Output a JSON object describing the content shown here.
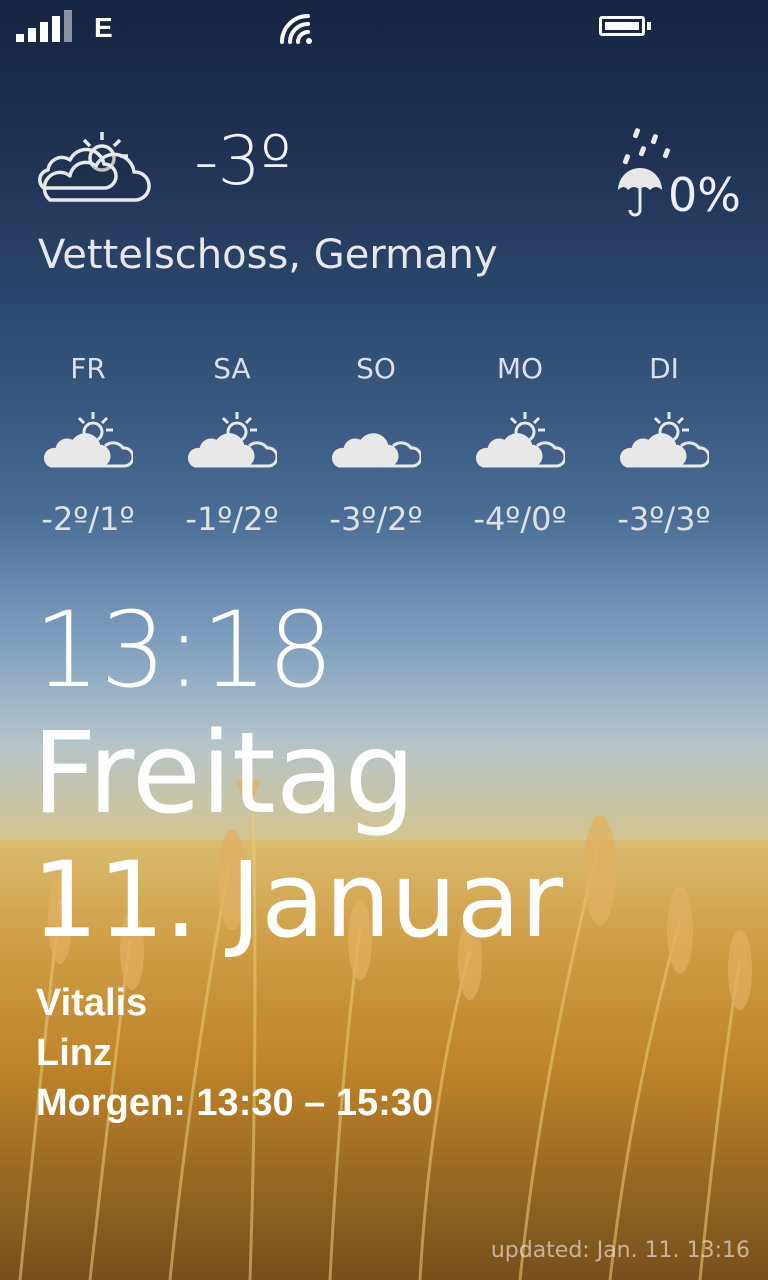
{
  "status": {
    "network_type": "E",
    "icons": [
      "signal-icon",
      "wifi-icon",
      "battery-icon"
    ]
  },
  "weather": {
    "current_temp": "-3º",
    "precip_chance": "0%",
    "location": "Vettelschoss, Germany",
    "current_icon": "partly-cloudy-icon",
    "precip_icon": "umbrella-rain-icon",
    "forecast": [
      {
        "day": "FR",
        "range": "-2º/1º",
        "icon": "partly-cloudy-icon"
      },
      {
        "day": "SA",
        "range": "-1º/2º",
        "icon": "partly-cloudy-icon"
      },
      {
        "day": "SO",
        "range": "-3º/2º",
        "icon": "cloudy-icon"
      },
      {
        "day": "MO",
        "range": "-4º/0º",
        "icon": "partly-cloudy-icon"
      },
      {
        "day": "DI",
        "range": "-3º/3º",
        "icon": "partly-cloudy-icon"
      }
    ]
  },
  "lockscreen": {
    "time": "13:18",
    "weekday": "Freitag",
    "date": "11. Januar"
  },
  "event": {
    "title": "Vitalis",
    "location": "Linz",
    "time": "Morgen: 13:30 – 15:30"
  },
  "updated": "updated: Jan. 11. 13:16"
}
